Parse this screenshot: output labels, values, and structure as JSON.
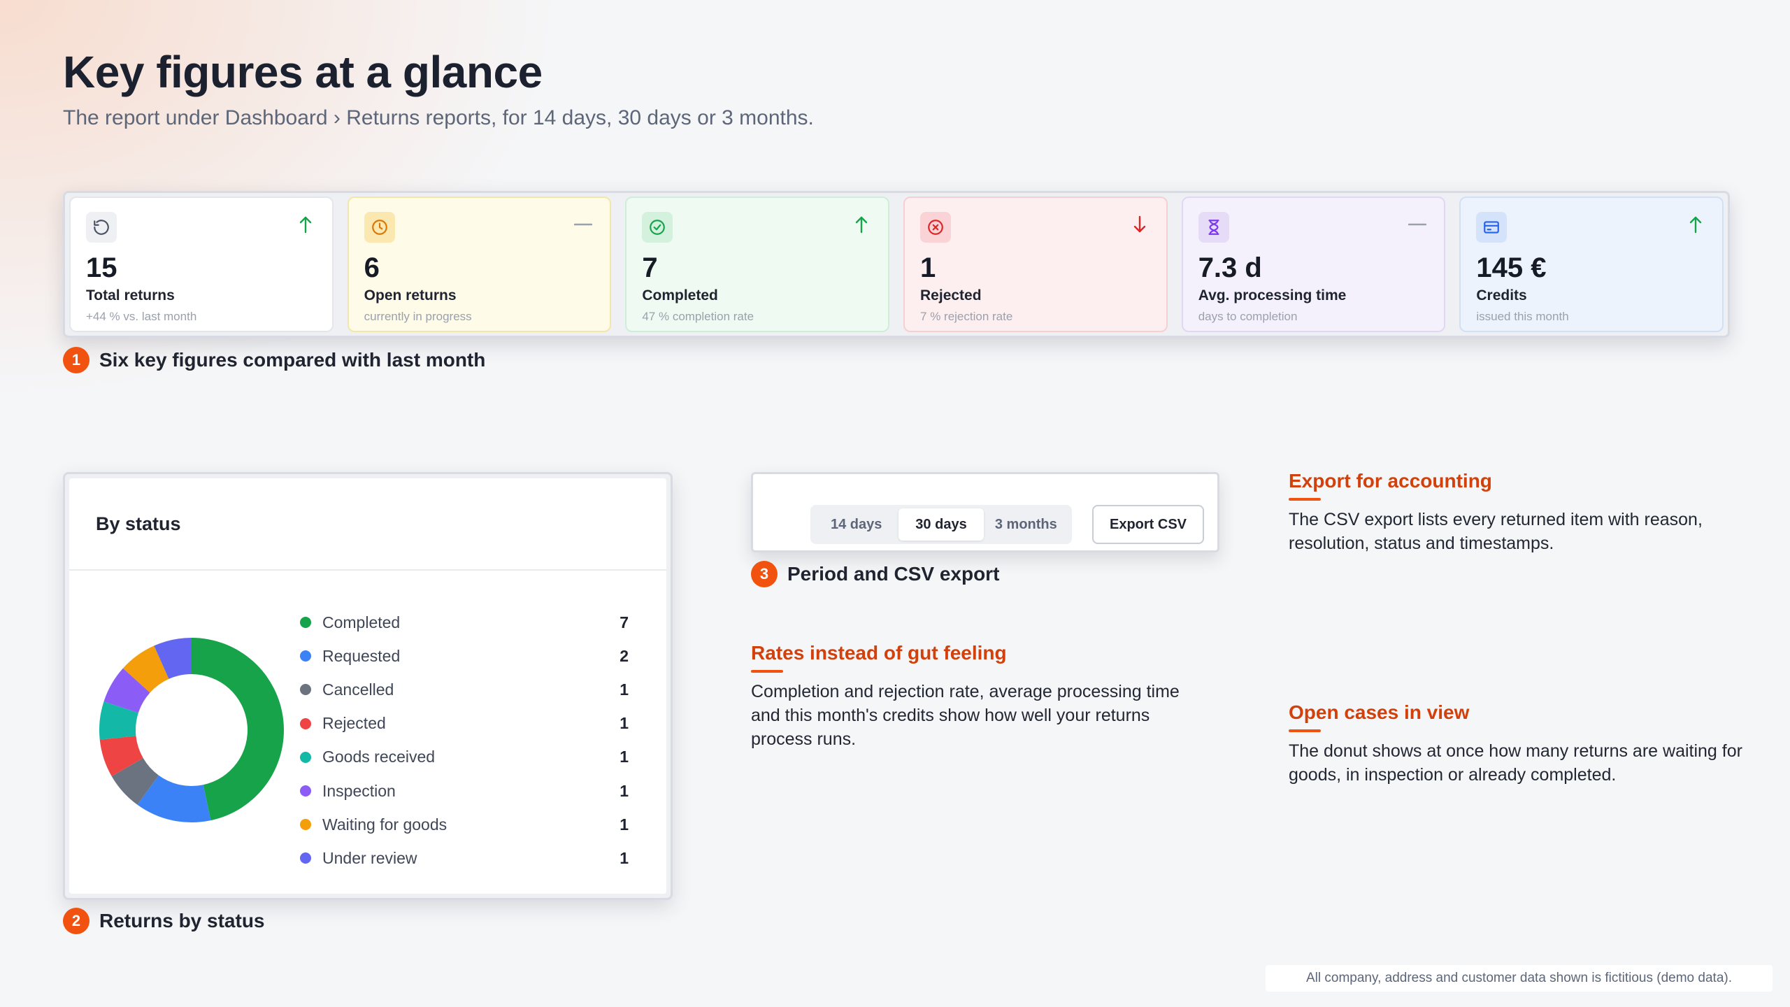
{
  "header": {
    "title": "Key figures at a glance",
    "subtitle": "The report under Dashboard › Returns reports, for 14 days, 30 days or 3 months."
  },
  "kpis": [
    {
      "value": "15",
      "label": "Total returns",
      "note": "+44 % vs. last month",
      "icon": "refresh-icon",
      "trend": "up"
    },
    {
      "value": "6",
      "label": "Open returns",
      "note": "currently in progress",
      "icon": "clock-icon",
      "trend": "flat"
    },
    {
      "value": "7",
      "label": "Completed",
      "note": "47 % completion rate",
      "icon": "check-circle-icon",
      "trend": "up"
    },
    {
      "value": "1",
      "label": "Rejected",
      "note": "7 % rejection rate",
      "icon": "x-circle-icon",
      "trend": "down"
    },
    {
      "value": "7.3 d",
      "label": "Avg. processing time",
      "note": "days to completion",
      "icon": "hourglass-icon",
      "trend": "flat"
    },
    {
      "value": "145 €",
      "label": "Credits",
      "note": "issued this month",
      "icon": "credit-card-icon",
      "trend": "up"
    }
  ],
  "callouts": {
    "c1": {
      "num": "1",
      "text": "Six key figures compared with last month"
    },
    "c2": {
      "num": "2",
      "text": "Returns by status"
    },
    "c3": {
      "num": "3",
      "text": "Period and CSV export"
    }
  },
  "status_card": {
    "title": "By status",
    "items": [
      {
        "label": "Completed",
        "count": "7",
        "color": "#16a34a"
      },
      {
        "label": "Requested",
        "count": "2",
        "color": "#3b82f6"
      },
      {
        "label": "Cancelled",
        "count": "1",
        "color": "#6b7280"
      },
      {
        "label": "Rejected",
        "count": "1",
        "color": "#ef4444"
      },
      {
        "label": "Goods received",
        "count": "1",
        "color": "#14b8a6"
      },
      {
        "label": "Inspection",
        "count": "1",
        "color": "#8b5cf6"
      },
      {
        "label": "Waiting for goods",
        "count": "1",
        "color": "#f59e0b"
      },
      {
        "label": "Under review",
        "count": "1",
        "color": "#6366f1"
      }
    ]
  },
  "toolbar": {
    "periods": [
      "14 days",
      "30 days",
      "3 months"
    ],
    "active_period": "30 days",
    "export_label": "Export CSV"
  },
  "notes": {
    "export": {
      "title": "Export for accounting",
      "body": "The CSV export lists every returned item with reason, resolution, status and timestamps."
    },
    "rates": {
      "title": "Rates instead of gut feeling",
      "body": "Completion and rejection rate, average processing time and this month's credits show how well your returns process runs."
    },
    "open": {
      "title": "Open cases in view",
      "body": "The donut shows at once how many returns are waiting for goods, in inspection or already completed."
    }
  },
  "footer": "All company, address and customer data shown is fictitious (demo data).",
  "colors": {
    "accent": "#f2520f",
    "accent_text": "#d2400c",
    "trend_up": "#16a34a",
    "trend_down": "#dc2626",
    "trend_flat": "#9aa1ad"
  }
}
